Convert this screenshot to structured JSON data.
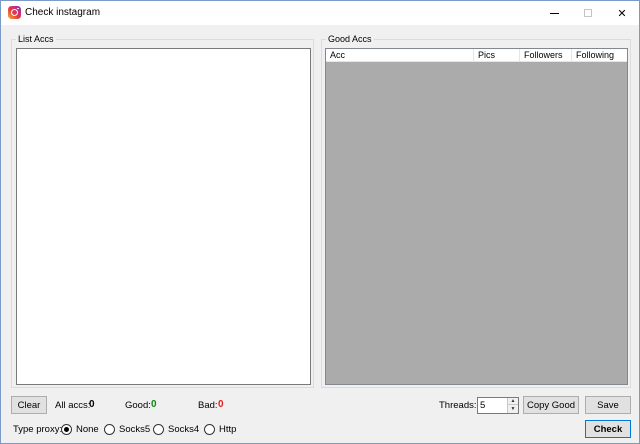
{
  "window": {
    "title": "Check instagram",
    "icon": "instagram-icon",
    "controls": {
      "minimize": "—",
      "maximize": "☐",
      "close": "✕"
    }
  },
  "list_group": {
    "legend": "List Accs",
    "content": ""
  },
  "good_group": {
    "legend": "Good Accs",
    "columns": [
      "Acc",
      "Pics",
      "Followers",
      "Following"
    ],
    "rows": []
  },
  "footer": {
    "clear_label": "Clear",
    "all_label": "All accs:",
    "all_value": "0",
    "good_label": "Good:",
    "good_value": "0",
    "bad_label": "Bad:",
    "bad_value": "0",
    "threads_label": "Threads:",
    "threads_value": "5",
    "copy_good_label": "Copy Good",
    "save_label": "Save",
    "proxy_label": "Type proxy:",
    "proxy_options": [
      "None",
      "Socks5",
      "Socks4",
      "Http"
    ],
    "proxy_selected": "None",
    "check_label": "Check"
  },
  "colors": {
    "good_value": "#0a8a0a",
    "bad_value": "#e0201b",
    "listview_bg": "#ababab",
    "focus_border": "#0078d7"
  }
}
